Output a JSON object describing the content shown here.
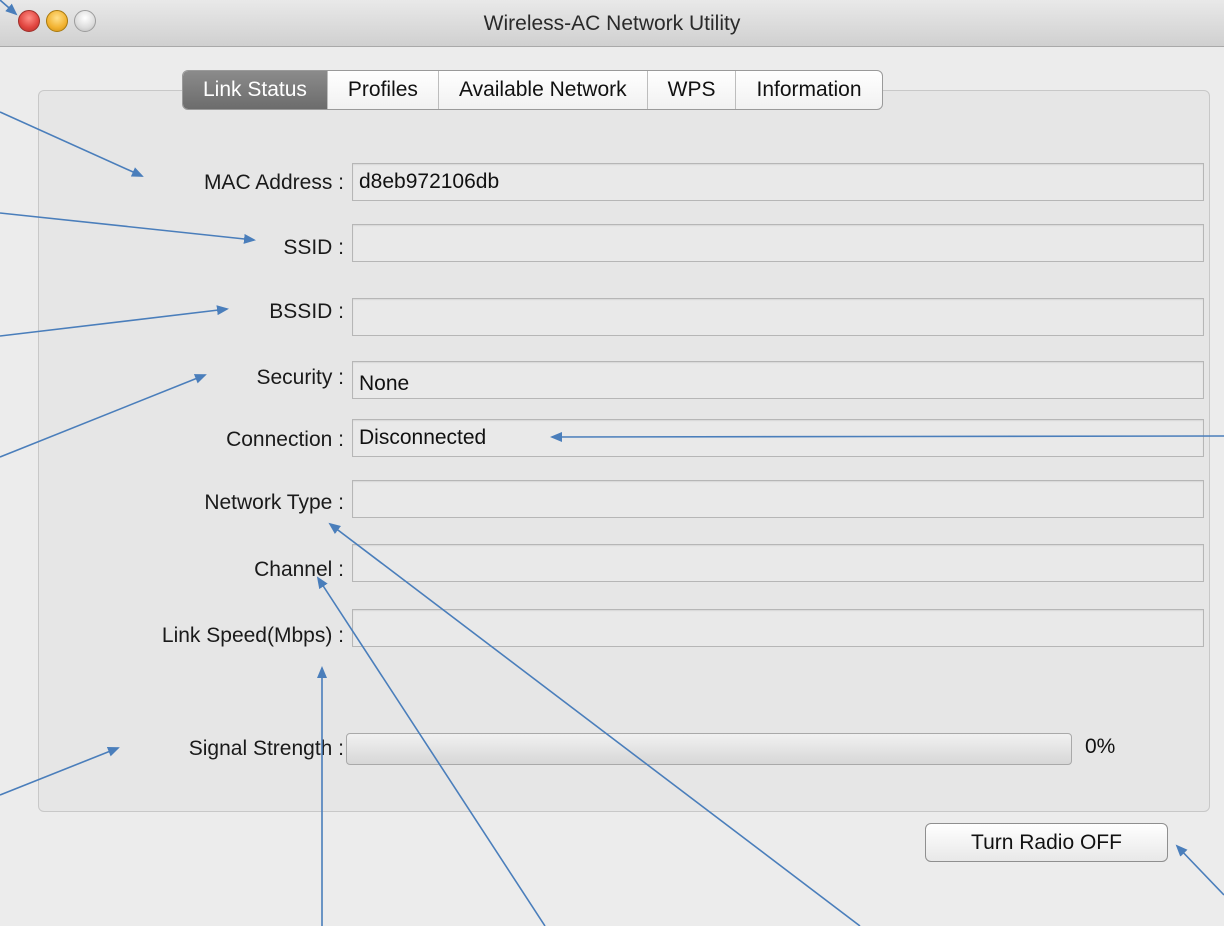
{
  "window": {
    "title": "Wireless-AC Network Utility"
  },
  "tabs": [
    {
      "label": "Link Status",
      "selected": true
    },
    {
      "label": "Profiles",
      "selected": false
    },
    {
      "label": "Available Network",
      "selected": false
    },
    {
      "label": "WPS",
      "selected": false
    },
    {
      "label": "Information",
      "selected": false
    }
  ],
  "fields": {
    "mac_address": {
      "label": "MAC Address :",
      "value": "d8eb972106db"
    },
    "ssid": {
      "label": "SSID :",
      "value": ""
    },
    "bssid": {
      "label": "BSSID :",
      "value": ""
    },
    "security": {
      "label": "Security :",
      "value": "None"
    },
    "connection": {
      "label": "Connection :",
      "value": "Disconnected"
    },
    "network_type": {
      "label": "Network Type :",
      "value": ""
    },
    "channel": {
      "label": "Channel :",
      "value": ""
    },
    "link_speed": {
      "label": "Link Speed(Mbps) :",
      "value": ""
    }
  },
  "signal": {
    "label": "Signal Strength :",
    "value_text": "0%",
    "percent": 0
  },
  "buttons": {
    "radio_toggle": "Turn Radio OFF"
  },
  "colors": {
    "annotation_arrow": "#4a7ebb",
    "selected_tab": "#7a7a7a",
    "window_bg": "#ececec"
  },
  "icons": {
    "close": "close-icon",
    "minimize": "minimize-icon",
    "zoom": "zoom-icon"
  }
}
